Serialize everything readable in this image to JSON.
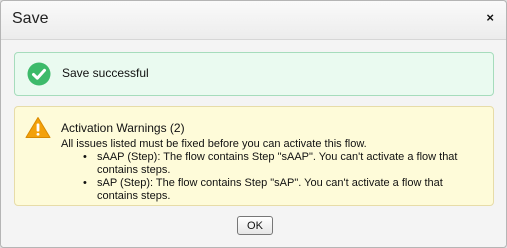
{
  "dialog": {
    "title": "Save",
    "close_label": "×"
  },
  "success": {
    "icon": "check-circle-icon",
    "text": "Save successful"
  },
  "warning": {
    "icon": "warning-triangle-icon",
    "title": "Activation Warnings (2)",
    "detail": "All issues listed must be fixed before you can activate this flow.",
    "items": [
      {
        "text": "sAAP (Step): The flow contains Step \"sAAP\". You can't activate a flow that contains steps."
      },
      {
        "text": "sAP (Step): The flow contains Step \"sAP\". You can't activate a flow that contains steps."
      }
    ]
  },
  "ok_label": "OK",
  "colors": {
    "success_green": "#3dba6a",
    "warning_orange": "#f3a10a"
  }
}
